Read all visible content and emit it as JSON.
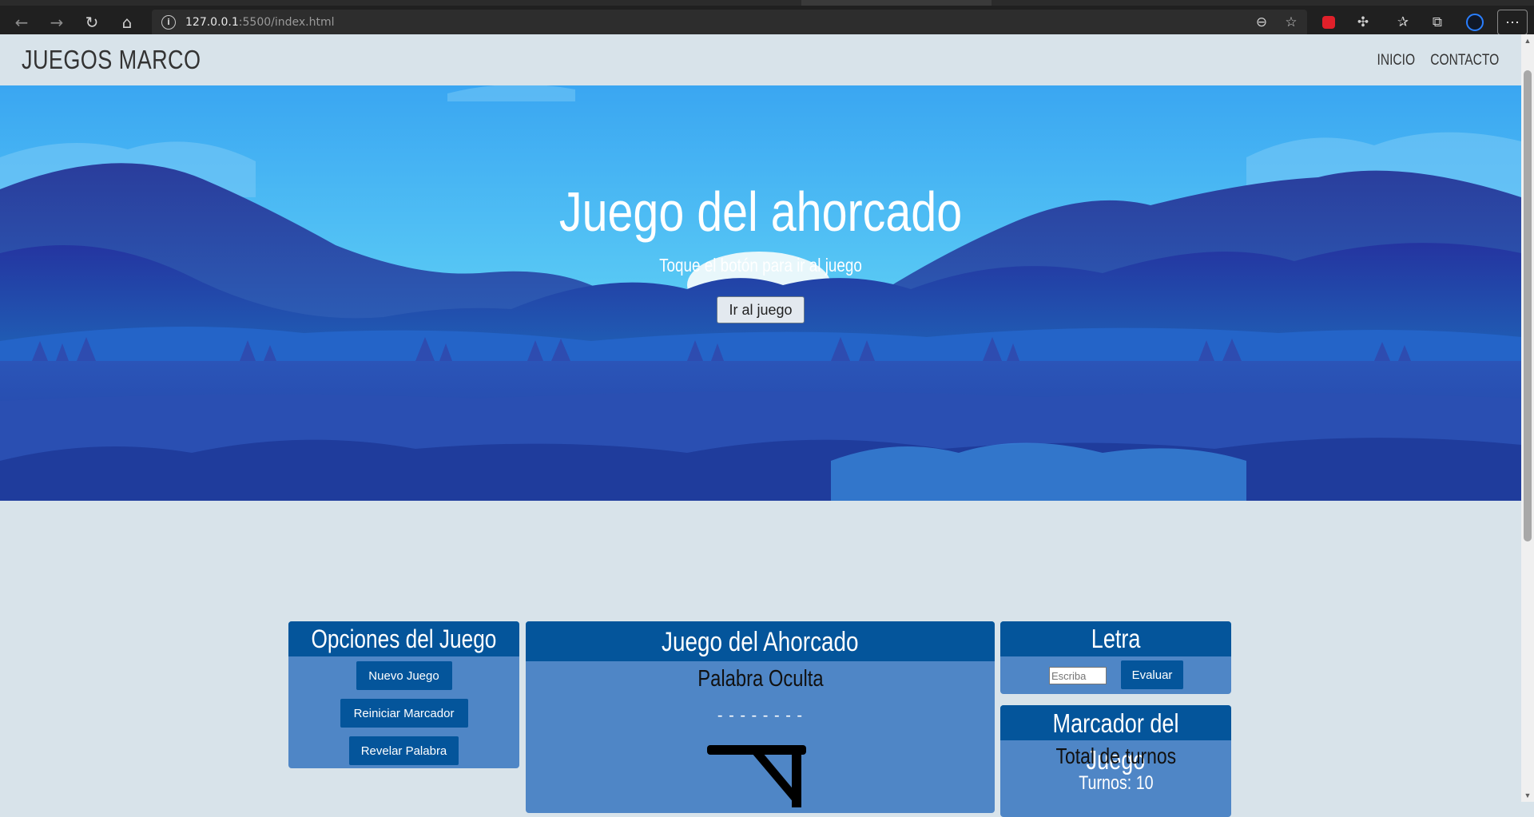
{
  "browser": {
    "url_host": "127.0.0.1",
    "url_rest": ":5500/index.html",
    "more_label": "···"
  },
  "navbar": {
    "brand": "JUEGOS MARCO",
    "links": [
      "INICIO",
      "CONTACTO"
    ]
  },
  "hero": {
    "title": "Juego del ahorcado",
    "subtitle": "Toque el botón para ir al juego",
    "button": "Ir al juego"
  },
  "options_panel": {
    "title": "Opciones del Juego",
    "buttons": [
      "Nuevo Juego",
      "Reiniciar Marcador",
      "Revelar Palabra"
    ]
  },
  "game_panel": {
    "title": "Juego del Ahorcado",
    "subtitle": "Palabra Oculta",
    "hidden_word": "- - - - - - - -"
  },
  "letter_panel": {
    "title": "Letra",
    "input_placeholder": "Escriba",
    "button": "Evaluar"
  },
  "score_panel": {
    "title": "Marcador del Juego",
    "subtitle": "Total de turnos",
    "turns": "Turnos: 10"
  },
  "colors": {
    "panel_header": "#04559b",
    "panel_body": "#4f86c6",
    "page_bg": "#d8e3ea"
  }
}
